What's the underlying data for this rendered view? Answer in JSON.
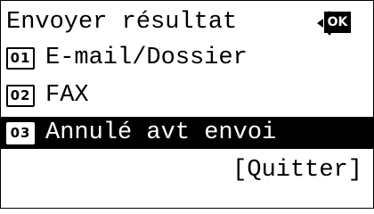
{
  "title": "Envoyer résultat",
  "nav_icon": "dpad-icon",
  "ok_label": "OK",
  "items": [
    {
      "number": "01",
      "label": "E-mail/Dossier"
    },
    {
      "number": "02",
      "label": "FAX"
    },
    {
      "number": "03",
      "label": "Annulé avt envoi",
      "selected": true
    }
  ],
  "softkey": {
    "label": "[Quitter]"
  },
  "colors": {
    "selected_bg": "#000000",
    "selected_fg": "#ffffff"
  }
}
